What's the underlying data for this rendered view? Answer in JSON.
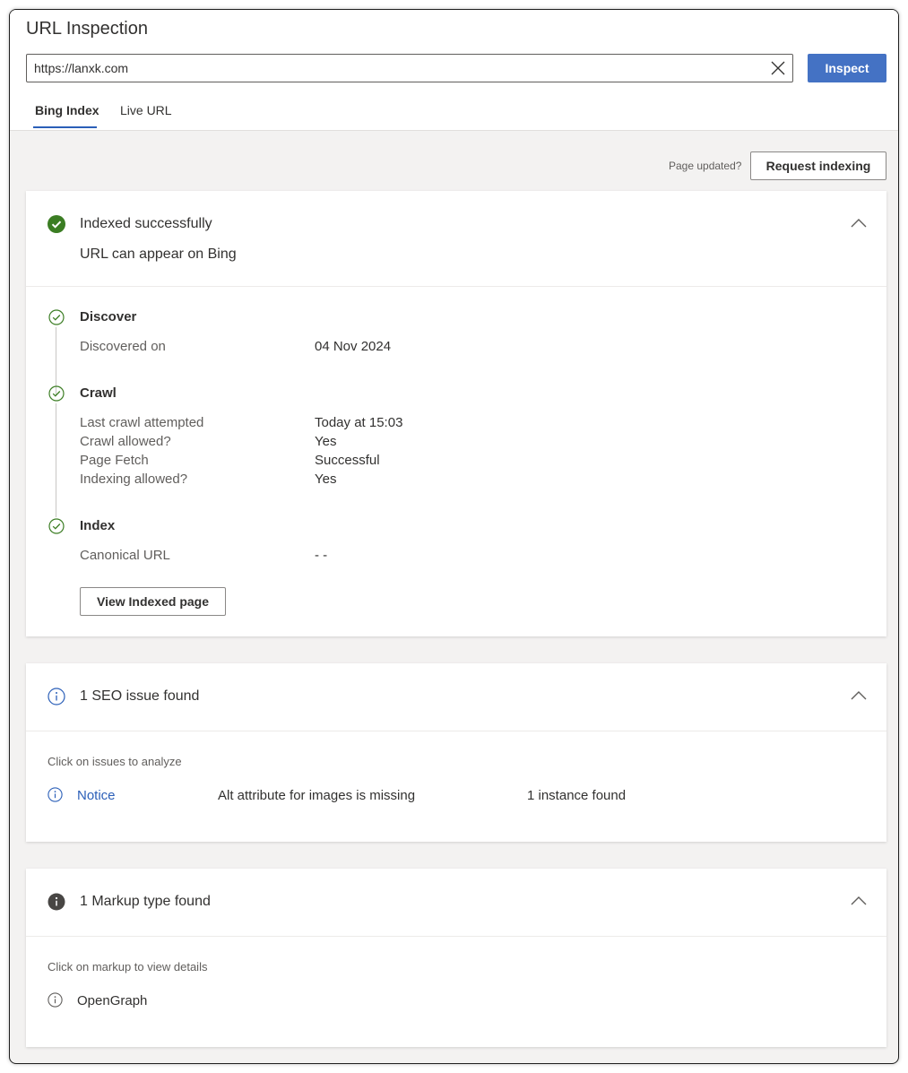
{
  "header": {
    "title": "URL Inspection",
    "url_value": "https://lanxk.com",
    "inspect_label": "Inspect",
    "tabs": [
      {
        "label": "Bing Index",
        "active": true
      },
      {
        "label": "Live URL",
        "active": false
      }
    ]
  },
  "toolbar": {
    "page_updated": "Page updated?",
    "request_label": "Request indexing"
  },
  "index_card": {
    "status_title": "Indexed successfully",
    "status_subtitle": "URL can appear on Bing",
    "status_color": "#3b7d23",
    "discover": {
      "title": "Discover",
      "rows": [
        {
          "label": "Discovered on",
          "value": "04 Nov 2024"
        }
      ]
    },
    "crawl": {
      "title": "Crawl",
      "rows": [
        {
          "label": "Last crawl attempted",
          "value": "Today at 15:03"
        },
        {
          "label": "Crawl allowed?",
          "value": "Yes"
        },
        {
          "label": "Page Fetch",
          "value": "Successful"
        },
        {
          "label": "Indexing allowed?",
          "value": "Yes"
        }
      ]
    },
    "index": {
      "title": "Index",
      "rows": [
        {
          "label": "Canonical URL",
          "value": "- -"
        }
      ]
    },
    "view_button": "View Indexed page"
  },
  "seo_card": {
    "title": "1 SEO issue found",
    "hint": "Click on issues to analyze",
    "issue": {
      "severity": "Notice",
      "description": "Alt attribute for images is missing",
      "count": "1 instance found"
    },
    "accent_color": "#2b5fb8"
  },
  "markup_card": {
    "title": "1 Markup type found",
    "hint": "Click on markup to view details",
    "item": "OpenGraph"
  }
}
